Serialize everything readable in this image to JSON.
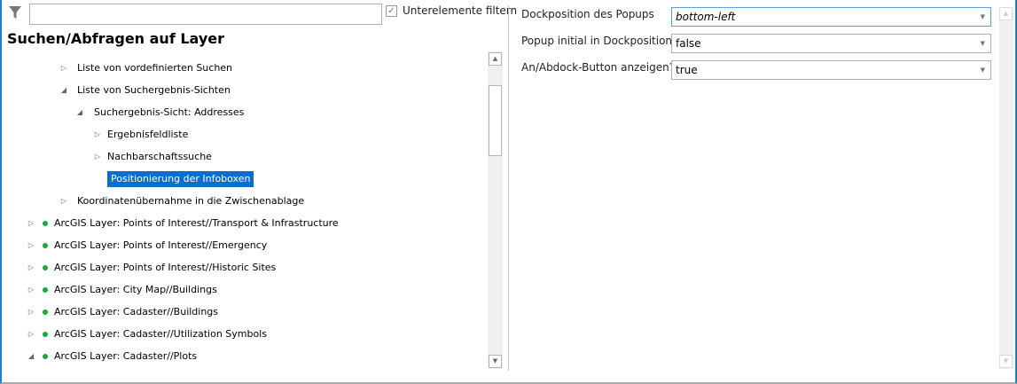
{
  "filter": {
    "icon": "filter-icon",
    "value": "",
    "checkbox_label": "Unterelemente filtern",
    "checked": true
  },
  "title": "Suchen/Abfragen auf Layer",
  "tree": [
    {
      "label": "Liste von vordefinierten Suchen",
      "level": 3,
      "expanded": false
    },
    {
      "label": "Liste von Suchergebnis-Sichten",
      "level": 3,
      "expanded": true
    },
    {
      "label": "Suchergebnis-Sicht: Addresses",
      "level": 4,
      "expanded": true
    },
    {
      "label": "Ergebnisfeldliste",
      "level": 5,
      "expanded": false
    },
    {
      "label": "Nachbarschaftssuche",
      "level": 5,
      "expanded": false
    },
    {
      "label": "Positionierung der Infoboxen",
      "level": 5,
      "selected": true
    },
    {
      "label": "Koordinatenübernahme in die Zwischenablage",
      "level": 3,
      "expanded": false
    },
    {
      "label": "ArcGIS Layer: Points of Interest//Transport & Infrastructure",
      "level": 1,
      "expanded": false
    },
    {
      "label": "ArcGIS Layer: Points of Interest//Emergency",
      "level": 1,
      "expanded": false
    },
    {
      "label": "ArcGIS Layer: Points of Interest//Historic Sites",
      "level": 1,
      "expanded": false
    },
    {
      "label": "ArcGIS Layer: City Map//Buildings",
      "level": 1,
      "expanded": false
    },
    {
      "label": "ArcGIS Layer: Cadaster//Buildings",
      "level": 1,
      "expanded": false
    },
    {
      "label": "ArcGIS Layer: Cadaster//Utilization Symbols",
      "level": 1,
      "expanded": false
    },
    {
      "label": "ArcGIS Layer: Cadaster//Plots",
      "level": 1,
      "expanded": true
    }
  ],
  "properties": [
    {
      "label": "Dockposition des Popups",
      "value": "bottom-left",
      "italic": true,
      "focused": true
    },
    {
      "label": "Popup initial in Dockposition?",
      "value": "false"
    },
    {
      "label": "An/Abdock-Button anzeigen?",
      "value": "true"
    }
  ],
  "colors": {
    "accent": "#0a6ecf",
    "status_dot": "#1aaa3a",
    "window_border": "#1e7fd0"
  }
}
